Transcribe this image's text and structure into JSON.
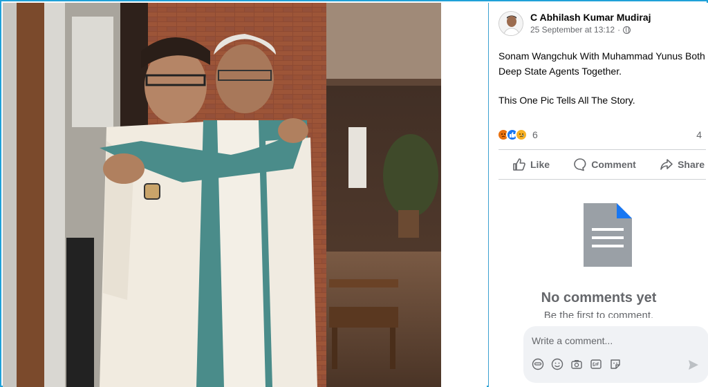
{
  "post": {
    "author": "C Abhilash Kumar Mudiraj",
    "timestamp": "25 September at 13:12",
    "text_line1": "Sonam Wangchuk With Muhammad Yunus Both",
    "text_line2": "Deep State Agents Together.",
    "text_line3": "This One Pic Tells All The Story."
  },
  "reactions": {
    "count": "6",
    "comments_count": "4",
    "icons": [
      "angry-icon",
      "like-icon",
      "sad-icon"
    ]
  },
  "actions": {
    "like": "Like",
    "comment": "Comment",
    "share": "Share"
  },
  "comments": {
    "empty_title": "No comments yet",
    "empty_sub": "Be the first to comment."
  },
  "composer": {
    "placeholder": "Write a comment..."
  },
  "colors": {
    "frame_border": "#1fa1d8",
    "brand_blue": "#1877f2",
    "secondary_text": "#65676b"
  }
}
